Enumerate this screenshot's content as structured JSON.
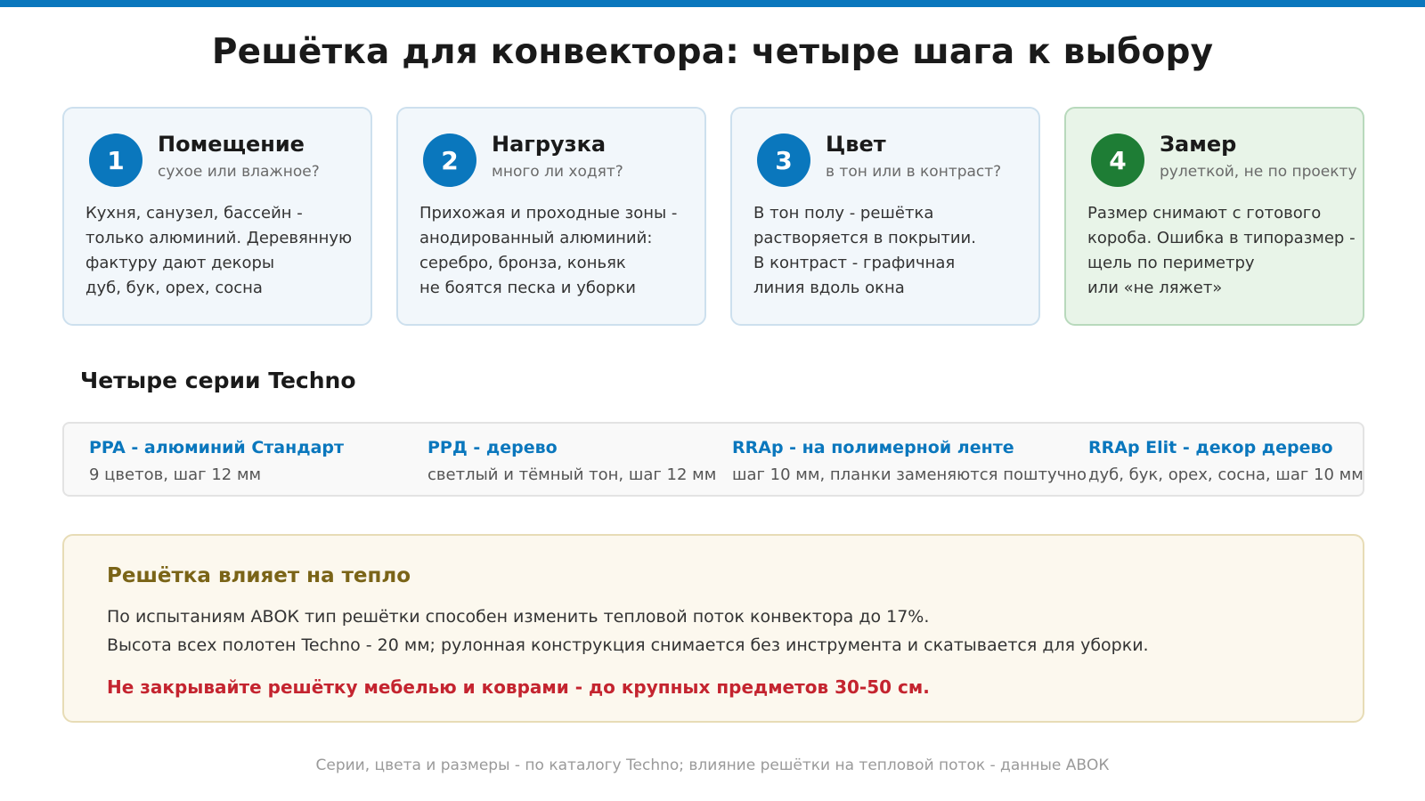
{
  "page": {
    "title": "Решётка для конвектора: четыре шага к выбору"
  },
  "steps": [
    {
      "num": "1",
      "title": "Помещение",
      "subtitle": "сухое или влажное?",
      "body": [
        "Кухня, санузел, бассейн -",
        "только алюминий. Деревянную",
        "фактуру дают декоры",
        "дуб, бук, орех, сосна"
      ]
    },
    {
      "num": "2",
      "title": "Нагрузка",
      "subtitle": "много ли ходят?",
      "body": [
        "Прихожая и проходные зоны -",
        "анодированный алюминий:",
        "серебро, бронза, коньяк",
        "не боятся песка и уборки"
      ]
    },
    {
      "num": "3",
      "title": "Цвет",
      "subtitle": "в тон или в контраст?",
      "body": [
        "В тон полу - решётка",
        "растворяется в покрытии.",
        "В контраст - графичная",
        "линия вдоль окна"
      ]
    },
    {
      "num": "4",
      "title": "Замер",
      "subtitle": "рулеткой, не по проекту",
      "body": [
        "Размер снимают с готового",
        "короба. Ошибка в типоразмер -",
        "щель по периметру",
        "или «не ляжет»"
      ]
    }
  ],
  "series_section": {
    "title": "Четыре серии Techno",
    "items": [
      {
        "name": "PPA - алюминий Стандарт",
        "desc": "9 цветов, шаг 12 мм"
      },
      {
        "name": "PPД - дерево",
        "desc": "светлый и тёмный тон, шаг 12 мм"
      },
      {
        "name": "RRAp - на полимерной ленте",
        "desc": "шаг 10 мм, планки заменяются поштучно"
      },
      {
        "name": "RRAp Elit - декор дерево",
        "desc": "дуб, бук, орех, сосна, шаг 10 мм"
      }
    ]
  },
  "notice": {
    "title": "Решётка влияет на тепло",
    "lines": [
      "По испытаниям АВОК тип решётки способен изменить тепловой поток конвектора до 17%.",
      "Высота всех полотен Techno - 20 мм; рулонная конструкция снимается без инструмента и скатывается для уборки."
    ],
    "warning": "Не закрывайте решётку мебелью и коврами - до крупных предметов 30-50 см."
  },
  "footer": {
    "text": "Серии, цвета и размеры - по каталогу Techno; влияние решётки на тепловой поток - данные АВОК"
  },
  "colors": {
    "accent": "#0a77bd",
    "step4_accent": "#1e7d35",
    "notice_title": "#7a6417",
    "warning": "#c4242f"
  }
}
